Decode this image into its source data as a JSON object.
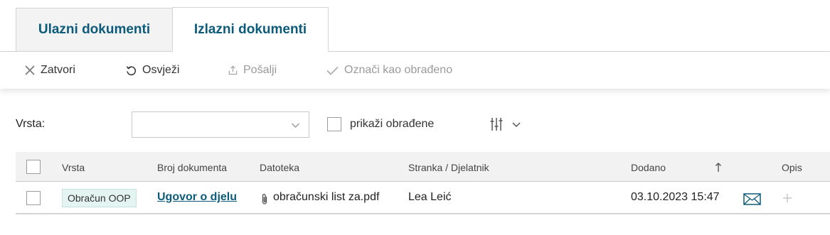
{
  "tabs": [
    {
      "label": "Ulazni dokumenti",
      "active": false
    },
    {
      "label": "Izlazni dokumenti",
      "active": true
    }
  ],
  "toolbar": {
    "close_label": "Zatvori",
    "refresh_label": "Osvježi",
    "send_label": "Pošalji",
    "mark_processed_label": "Označi kao obrađeno"
  },
  "filter": {
    "type_label": "Vrsta:",
    "type_value": "",
    "show_processed_label": "prikaži obrađene",
    "show_processed_checked": false
  },
  "table": {
    "columns": [
      "Vrsta",
      "Broj dokumenta",
      "Datoteka",
      "Stranka / Djelatnik",
      "Dodano",
      "Opis"
    ],
    "sort_column": "Dodano",
    "sort_direction": "ascending",
    "rows": [
      {
        "type": "Obračun OOP",
        "document_number": "Ugovor o djelu",
        "file": "obračunski list za.pdf",
        "party": "Lea Leić",
        "added": "03.10.2023 15:47"
      }
    ]
  },
  "colors": {
    "accent": "#0d5b7a",
    "badge_bg": "#e4f4f1"
  }
}
